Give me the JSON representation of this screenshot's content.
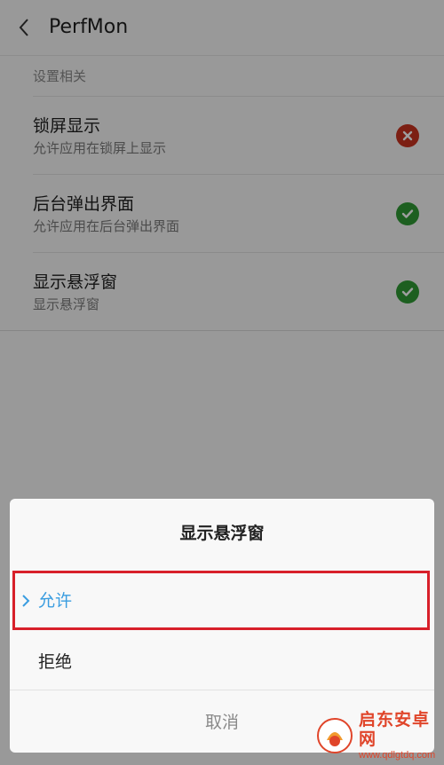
{
  "header": {
    "title": "PerfMon",
    "back_icon": "chevron-left-icon"
  },
  "section": {
    "label": "设置相关"
  },
  "settings": [
    {
      "title": "锁屏显示",
      "subtitle": "允许应用在锁屏上显示",
      "status": "denied",
      "status_icon": "x-circle-icon",
      "status_color": "#c9331f"
    },
    {
      "title": "后台弹出界面",
      "subtitle": "允许应用在后台弹出界面",
      "status": "allowed",
      "status_icon": "check-circle-icon",
      "status_color": "#2f9a35"
    },
    {
      "title": "显示悬浮窗",
      "subtitle": "显示悬浮窗",
      "status": "allowed",
      "status_icon": "check-circle-icon",
      "status_color": "#2f9a35"
    }
  ],
  "dialog": {
    "title": "显示悬浮窗",
    "options": [
      {
        "label": "允许",
        "selected": true
      },
      {
        "label": "拒绝",
        "selected": false
      }
    ],
    "cancel_label": "取消",
    "accent_color": "#3a9de0",
    "highlight_color": "#d8202a"
  },
  "watermark": {
    "name": "启东安卓网",
    "url": "www.qdlgtdq.com"
  }
}
